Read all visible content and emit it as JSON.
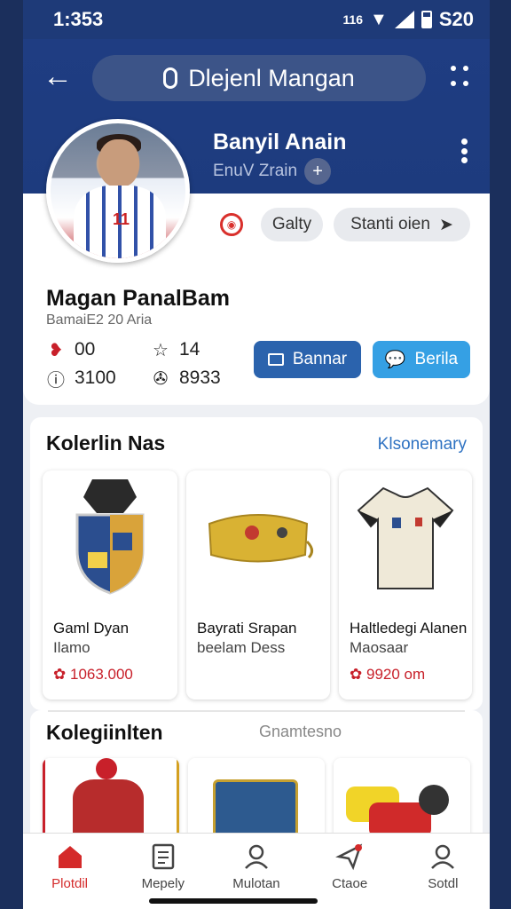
{
  "status_bar": {
    "time": "1:353",
    "right_text": "S20",
    "signal_text": "116"
  },
  "header": {
    "title": "Dlejenl Mangan",
    "name": "Banyil Anain",
    "subtitle": "EnuV Zrain"
  },
  "profile": {
    "chip_1": "Galty",
    "chip_2": "Stanti oien",
    "name": "Magan PanalBam",
    "sub": "BamaiE2 20 Aria",
    "stats": [
      {
        "icon": "heart-icon",
        "value": "00"
      },
      {
        "icon": "star-icon",
        "value": "14"
      },
      {
        "icon": "alert-icon",
        "value": "3100"
      },
      {
        "icon": "chat-icon",
        "value": "8933"
      }
    ],
    "button_1": "Bannar",
    "button_2": "Berila"
  },
  "collection": {
    "title": "Kolerlin Nas",
    "link": "Klsonemary",
    "items": [
      {
        "name": "Gaml Dyan",
        "sub": "Ilamo",
        "price": "1063.000",
        "icon": "crest-icon"
      },
      {
        "name": "Bayrati Srapan",
        "sub": "beelam Dess",
        "price": "",
        "icon": "bag-icon"
      },
      {
        "name": "Haltledegi Alanen",
        "sub": "Maosaar",
        "price": "9920 om",
        "icon": "jersey-icon"
      }
    ]
  },
  "collection2": {
    "title": "Kolegiinlten",
    "note": "Gnamtesno"
  },
  "bottom_nav": [
    {
      "label": "Plotdil",
      "icon": "home-icon",
      "active": true
    },
    {
      "label": "Mepely",
      "icon": "document-icon",
      "active": false
    },
    {
      "label": "Mulotan",
      "icon": "profile-icon",
      "active": false
    },
    {
      "label": "Ctaoe",
      "icon": "send-icon",
      "active": false
    },
    {
      "label": "Sotdl",
      "icon": "user-icon",
      "active": false
    }
  ],
  "colors": {
    "header": "#1e3a78",
    "accent_red": "#d42a2a",
    "primary_btn": "#2b63ad",
    "secondary_btn": "#35a0e4",
    "link": "#2e72c2"
  }
}
